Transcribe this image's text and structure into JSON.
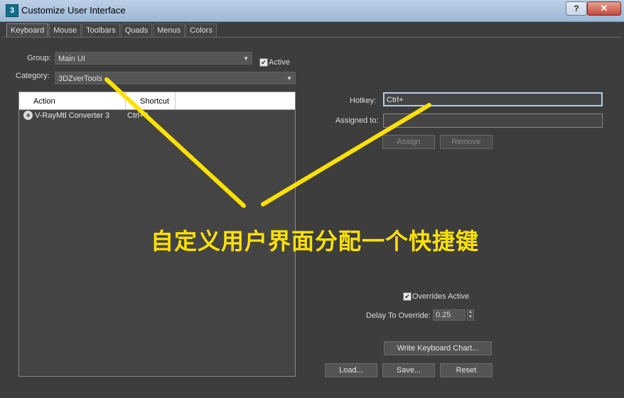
{
  "window": {
    "title": "Customize User Interface",
    "app_icon_text": "3",
    "help_label": "?",
    "close_label": "✕"
  },
  "tabs": [
    {
      "label": "Keyboard",
      "active": true
    },
    {
      "label": "Mouse"
    },
    {
      "label": "Toolbars"
    },
    {
      "label": "Quads"
    },
    {
      "label": "Menus"
    },
    {
      "label": "Colors"
    }
  ],
  "group": {
    "label": "Group:",
    "value": "Main UI"
  },
  "active": {
    "label": "Active",
    "checked": true
  },
  "category": {
    "label": "Category:",
    "value": "3DZverTools"
  },
  "list": {
    "columns": [
      "Action",
      "Shortcut"
    ],
    "rows": [
      {
        "icon": "vray-icon",
        "action": "V-RayMtl Converter 3",
        "shortcut": "Ctrl+0"
      }
    ]
  },
  "hotkey": {
    "label": "Hotkey:",
    "value": "Ctrl+"
  },
  "assigned_to": {
    "label": "Assigned to:",
    "value": ""
  },
  "buttons": {
    "assign": "Assign",
    "remove": "Remove",
    "write_chart": "Write Keyboard Chart...",
    "load": "Load...",
    "save": "Save...",
    "reset": "Reset"
  },
  "overrides_active": {
    "label": "Overrides Active",
    "checked": true
  },
  "delay": {
    "label": "Delay To Override:",
    "value": "0.25"
  },
  "annotation": {
    "text": "自定义用户界面分配一个快捷键",
    "color": "#ffe100"
  },
  "colors": {
    "background": "#3d3d3d",
    "annotation": "#ffe100"
  }
}
